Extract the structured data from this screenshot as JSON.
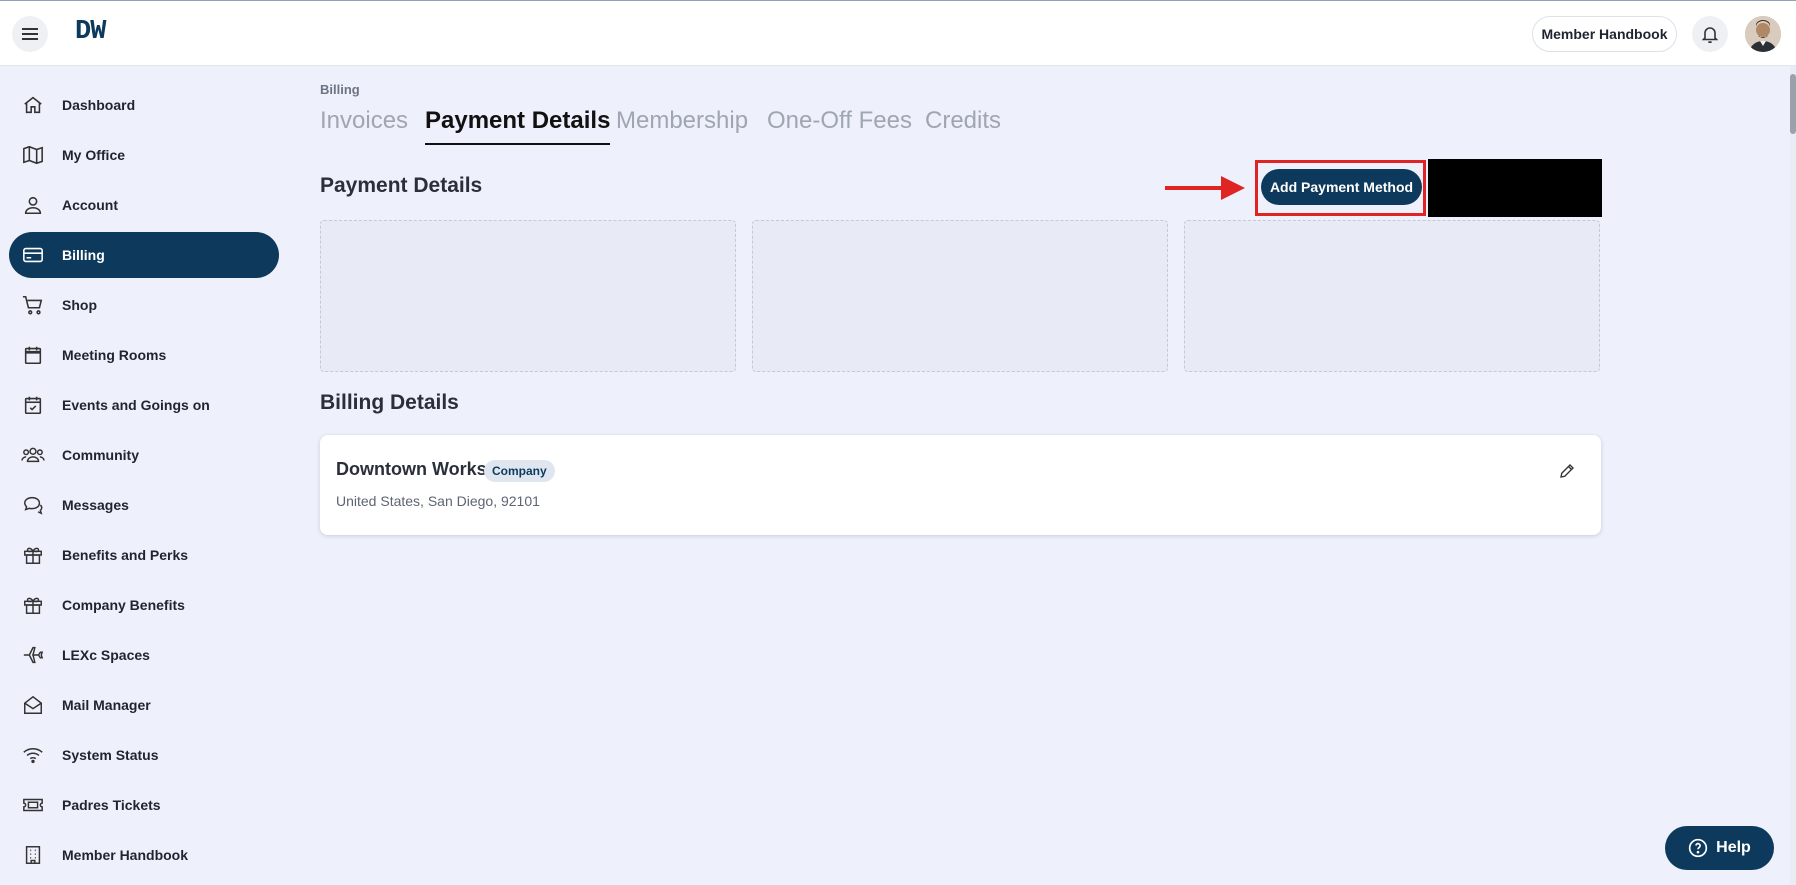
{
  "header": {
    "logo": "DW",
    "member_handbook_label": "Member Handbook"
  },
  "sidebar": {
    "items": [
      {
        "label": "Dashboard",
        "icon": "home-icon"
      },
      {
        "label": "My Office",
        "icon": "map-icon"
      },
      {
        "label": "Account",
        "icon": "user-icon"
      },
      {
        "label": "Billing",
        "icon": "credit-card-icon",
        "active": true
      },
      {
        "label": "Shop",
        "icon": "cart-icon"
      },
      {
        "label": "Meeting Rooms",
        "icon": "calendar-icon"
      },
      {
        "label": "Events and Goings on",
        "icon": "calendar-check-icon"
      },
      {
        "label": "Community",
        "icon": "users-icon"
      },
      {
        "label": "Messages",
        "icon": "chat-icon"
      },
      {
        "label": "Benefits and Perks",
        "icon": "gift-icon"
      },
      {
        "label": "Company Benefits",
        "icon": "gift-icon"
      },
      {
        "label": "LEXc Spaces",
        "icon": "plane-icon"
      },
      {
        "label": "Mail Manager",
        "icon": "mail-open-icon"
      },
      {
        "label": "System Status",
        "icon": "wifi-icon"
      },
      {
        "label": "Padres Tickets",
        "icon": "ticket-icon"
      },
      {
        "label": "Member Handbook",
        "icon": "building-icon"
      }
    ]
  },
  "main": {
    "breadcrumb": "Billing",
    "tabs": [
      {
        "label": "Invoices"
      },
      {
        "label": "Payment Details",
        "active": true
      },
      {
        "label": "Membership"
      },
      {
        "label": "One-Off Fees"
      },
      {
        "label": "Credits"
      }
    ],
    "payment_details_title": "Payment Details",
    "add_payment_method_label": "Add Payment Method",
    "billing_details_title": "Billing Details",
    "billing_card": {
      "name": "Downtown Works",
      "badge": "Company",
      "address": "United States, San Diego, 92101"
    }
  },
  "help_label": "Help",
  "colors": {
    "brand": "#0d3a5c",
    "background": "#eef1fb",
    "annotation": "#e02424"
  }
}
